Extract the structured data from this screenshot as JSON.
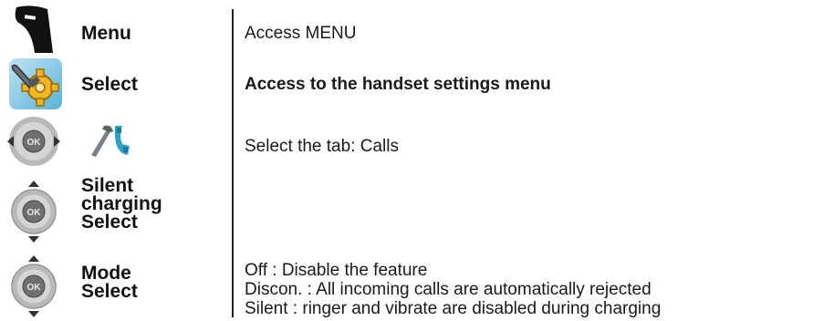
{
  "steps": [
    {
      "icon": "softkey-icon",
      "label": "Menu",
      "description": "Access MENU"
    },
    {
      "icon": "settings-gear-wrench-icon",
      "label": "Select",
      "description": "Access to the handset settings menu"
    },
    {
      "icon": "navigation-pad-left-right-icon",
      "secondary_icon": "calls-settings-tab-icon",
      "label": "",
      "description": "Select the tab: Calls"
    },
    {
      "icon": "navigation-pad-up-down-icon",
      "label_lines": [
        "Silent",
        "charging",
        "Select"
      ],
      "description": ""
    },
    {
      "icon": "navigation-pad-up-down-icon",
      "label_lines": [
        "Mode",
        "Select"
      ],
      "description_lines": [
        "Off : Disable the feature",
        "Discon. : All incoming calls are automatically rejected",
        "Silent : ringer and vibrate are disabled during charging"
      ]
    }
  ],
  "nav_pad_center_text": "OK"
}
